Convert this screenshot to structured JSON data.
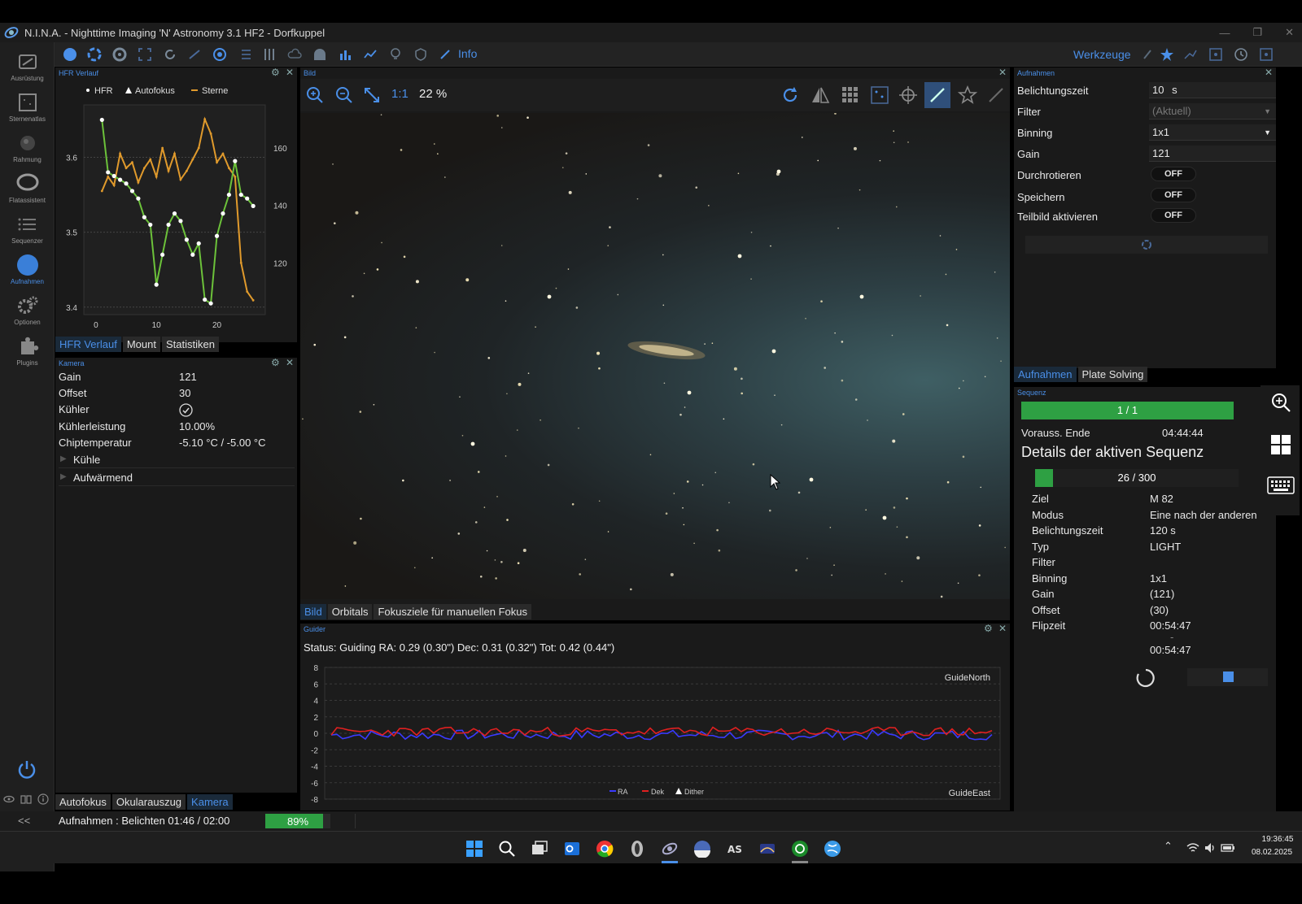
{
  "window": {
    "title": "N.I.N.A. - Nighttime Imaging 'N' Astronomy 3.1 HF2  -  Dorfkuppel",
    "controls": [
      "—",
      "❐",
      "✕"
    ]
  },
  "nav": [
    {
      "label": "Ausrüstung",
      "icon": "equipment-icon"
    },
    {
      "label": "Sternenatlas",
      "icon": "star-atlas-icon"
    },
    {
      "label": "Rahmung",
      "icon": "framing-icon"
    },
    {
      "label": "Flatassistent",
      "icon": "flat-wizard-icon"
    },
    {
      "label": "Sequenzer",
      "icon": "sequencer-icon"
    },
    {
      "label": "Aufnahmen",
      "icon": "imaging-icon",
      "active": true
    },
    {
      "label": "Optionen",
      "icon": "options-icon"
    },
    {
      "label": "Plugins",
      "icon": "plugins-icon"
    }
  ],
  "nav_bottom": {
    "collapse": "<<"
  },
  "toolbar": {
    "info": "Info",
    "werkzeuge": "Werkzeuge"
  },
  "hfr": {
    "panel_title": "HFR Verlauf",
    "legend": [
      "HFR",
      "Autofokus",
      "Sterne"
    ],
    "left_ticks": [
      "3.6",
      "3.5",
      "3.4"
    ],
    "right_ticks": [
      "160",
      "140",
      "120"
    ],
    "x_ticks": [
      "0",
      "10",
      "20"
    ],
    "tabs": [
      "HFR Verlauf",
      "Mount",
      "Statistiken"
    ]
  },
  "chart_data": [
    {
      "type": "line",
      "title": "",
      "series": [
        {
          "name": "HFR",
          "color": "#6cc23a",
          "y_axis": "left",
          "x": [
            1,
            2,
            3,
            4,
            5,
            6,
            7,
            8,
            9,
            10,
            11,
            12,
            13,
            14,
            15,
            16,
            17,
            18,
            19,
            20,
            21,
            22,
            23,
            24,
            25,
            26
          ],
          "values": [
            3.65,
            3.58,
            3.575,
            3.57,
            3.565,
            3.555,
            3.545,
            3.52,
            3.51,
            3.43,
            3.47,
            3.51,
            3.525,
            3.515,
            3.49,
            3.47,
            3.485,
            3.41,
            3.405,
            3.495,
            3.525,
            3.55,
            3.595,
            3.55,
            3.545,
            3.535
          ]
        },
        {
          "name": "Sterne",
          "color": "#e09a2c",
          "y_axis": "right",
          "x": [
            1,
            2,
            3,
            4,
            5,
            6,
            7,
            8,
            9,
            10,
            11,
            12,
            13,
            14,
            15,
            16,
            17,
            18,
            19,
            20,
            21,
            22,
            23,
            24,
            25,
            26
          ],
          "values": [
            145,
            150,
            147,
            158,
            153,
            155,
            148,
            153,
            156,
            150,
            160,
            152,
            158,
            149,
            152,
            156,
            160,
            170,
            165,
            155,
            158,
            153,
            150,
            120,
            110,
            107
          ]
        }
      ],
      "xlim": [
        -2,
        28
      ],
      "ylim_left": [
        3.39,
        3.67
      ],
      "ylim_right": [
        102,
        175
      ],
      "legend": "top"
    },
    {
      "type": "line",
      "title": "",
      "series": [
        {
          "name": "RA",
          "color": "#3a3aff"
        },
        {
          "name": "Dek",
          "color": "#e02020"
        },
        {
          "name": "Dither",
          "color": "#ffffff"
        }
      ],
      "y_ticks": [
        "8",
        "6",
        "4",
        "2",
        "0",
        "-2",
        "-4",
        "-6",
        "-8"
      ],
      "ylim": [
        -8,
        8
      ],
      "labels": {
        "top_right": "GuideNorth",
        "bottom_right": "GuideEast"
      },
      "legend": "bottom-center"
    }
  ],
  "camera": {
    "panel_title": "Kamera",
    "rows": [
      {
        "label": "Gain",
        "value": "121"
      },
      {
        "label": "Offset",
        "value": "30"
      },
      {
        "label": "Kühler",
        "value": ""
      },
      {
        "label": "Kühlerleistung",
        "value": "10.00%"
      },
      {
        "label": "Chiptemperatur",
        "value": "-5.10 °C / -5.00 °C"
      }
    ],
    "expanders": [
      "Kühle",
      "Aufwärmend"
    ],
    "bottom_tabs": [
      "Autofokus",
      "Okularauszug",
      "Kamera"
    ]
  },
  "bild": {
    "panel_title": "Bild",
    "zoom_ratio": "1:1",
    "zoom_percent": "22 %",
    "tabs": [
      "Bild",
      "Orbitals",
      "Fokusziele für manuellen Fokus"
    ]
  },
  "guider": {
    "panel_title": "Guider",
    "status": "Status: Guiding RA: 0.29 (0.30\") Dec: 0.31 (0.32\") Tot: 0.42 (0.44\")"
  },
  "aufnahmen": {
    "panel_title": "Aufnahmen",
    "rows": [
      {
        "label": "Belichtungszeit",
        "value": "10",
        "unit": "s"
      },
      {
        "label": "Filter",
        "value": "(Aktuell)"
      },
      {
        "label": "Binning",
        "value": "1x1"
      },
      {
        "label": "Gain",
        "value": "121"
      },
      {
        "label": "Durchrotieren",
        "toggle": "OFF"
      },
      {
        "label": "Speichern",
        "toggle": "OFF"
      },
      {
        "label": "Teilbild aktivieren",
        "toggle": "OFF"
      }
    ],
    "tabs": [
      "Aufnahmen",
      "Plate Solving"
    ]
  },
  "sequenz": {
    "panel_title": "Sequenz",
    "progress_label": "1 / 1",
    "progress": 1.0,
    "end_label": "Vorauss. Ende",
    "end_value": "04:44:44",
    "heading": "Details der aktiven Sequenz",
    "sub_progress_label": "26 / 300",
    "sub_progress": 0.087,
    "details": [
      {
        "label": "Ziel",
        "value": "M 82"
      },
      {
        "label": "Modus",
        "value": "Eine nach der anderen"
      },
      {
        "label": "Belichtungszeit",
        "value": "120 s"
      },
      {
        "label": "Typ",
        "value": "LIGHT"
      },
      {
        "label": "Filter",
        "value": ""
      },
      {
        "label": "Binning",
        "value": "1x1"
      },
      {
        "label": "Gain",
        "value": "(121)"
      },
      {
        "label": "Offset",
        "value": "(30)"
      },
      {
        "label": "Flipzeit",
        "value": "00:54:47"
      }
    ],
    "flip_dash": "-",
    "flip_second": "00:54:47"
  },
  "status": {
    "text": "Aufnahmen :  Belichten 01:46 / 02:00",
    "percent_label": "89%",
    "progress": 0.89
  },
  "taskbar": {
    "time": "19:36:45",
    "date": "08.02.2025"
  }
}
